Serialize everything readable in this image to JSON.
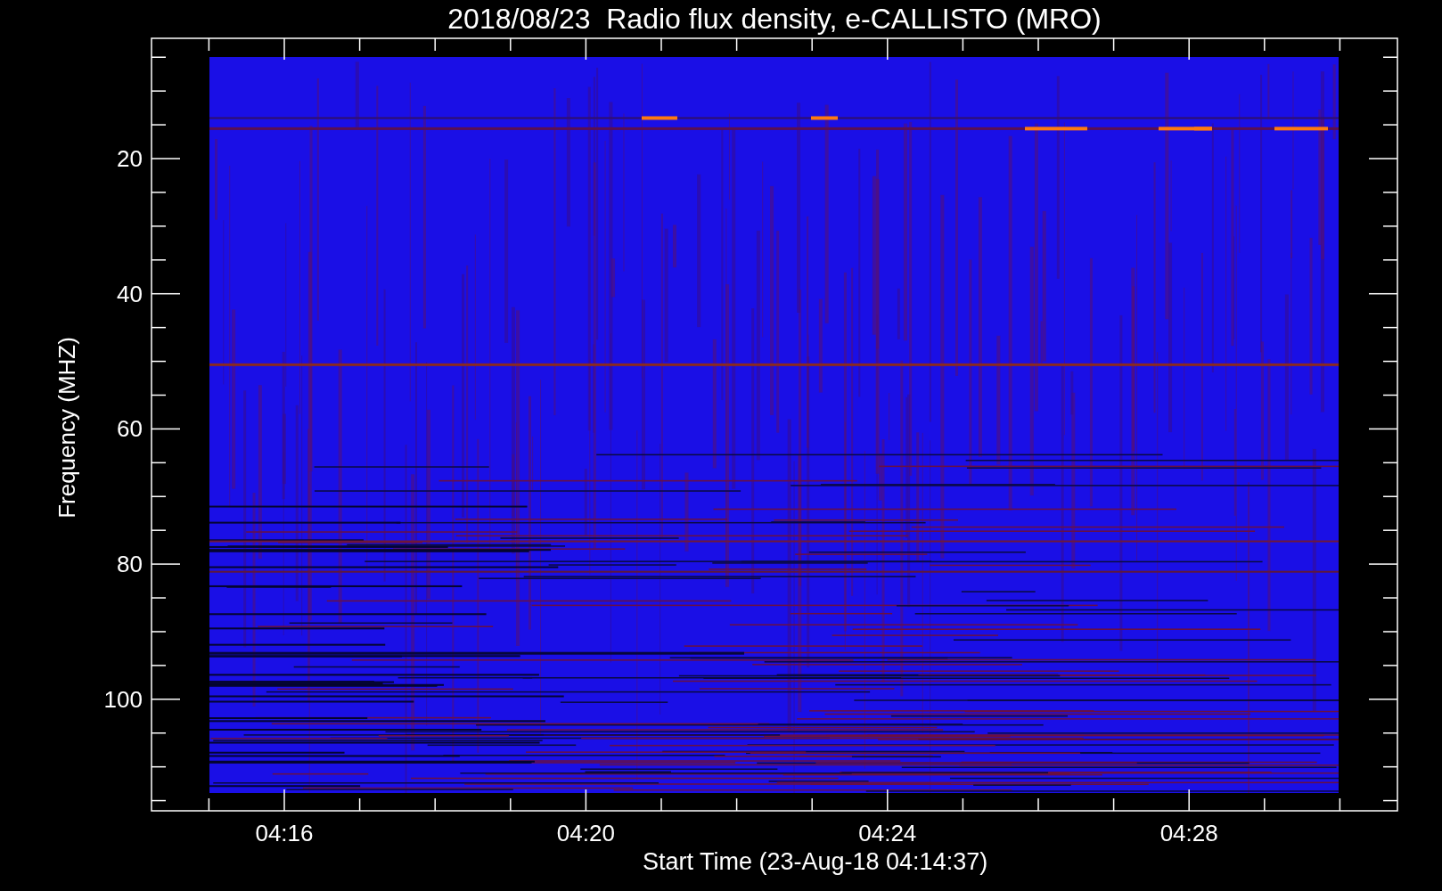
{
  "title": "2018/08/23  Radio flux density, e-CALLISTO (MRO)",
  "y_axis": {
    "label": "Frequency (MHZ)",
    "ticks": [
      "20",
      "40",
      "60",
      "80",
      "100"
    ]
  },
  "x_axis": {
    "label": "Start Time (23-Aug-18 04:14:37)",
    "ticks": [
      "04:16",
      "04:20",
      "04:24",
      "04:28"
    ]
  }
}
